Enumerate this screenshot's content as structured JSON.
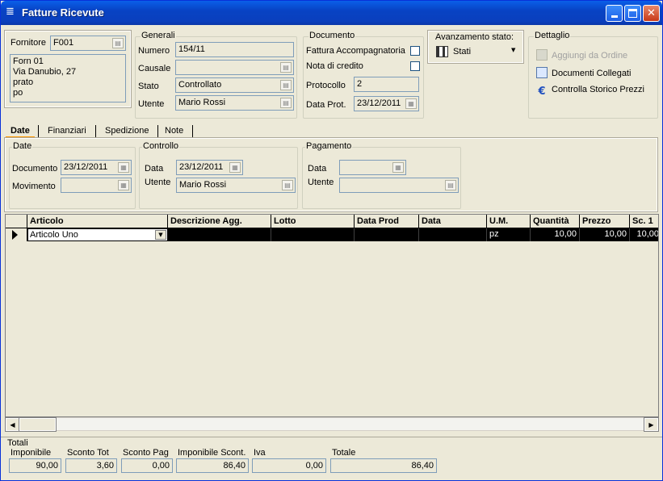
{
  "window": {
    "title": "Fatture Ricevute"
  },
  "fornitore": {
    "label": "Fornitore",
    "code": "F001",
    "address_lines": [
      "Forn 01",
      "Via Danubio, 27",
      "prato",
      "po"
    ]
  },
  "generali": {
    "title": "Generali",
    "numero_label": "Numero",
    "numero": "154/11",
    "causale_label": "Causale",
    "causale": "",
    "stato_label": "Stato",
    "stato": "Controllato",
    "utente_label": "Utente",
    "utente": "Mario Rossi"
  },
  "documento": {
    "title": "Documento",
    "fattura_accomp_label": "Fattura Accompagnatoria",
    "nota_credito_label": "Nota di credito",
    "protocollo_label": "Protocollo",
    "protocollo": "2",
    "data_prot_label": "Data Prot.",
    "data_prot": "23/12/2011"
  },
  "avanzamento": {
    "title": "Avanzamento stato:",
    "button_label": "Stati"
  },
  "dettaglio": {
    "title": "Dettaglio",
    "items": [
      {
        "label": "Aggiungi da Ordine",
        "icon": "document-icon",
        "enabled": false
      },
      {
        "label": "Documenti Collegati",
        "icon": "linked-documents-icon",
        "enabled": true
      },
      {
        "label": "Controlla Storico Prezzi",
        "icon": "euro-icon",
        "enabled": true
      }
    ]
  },
  "tabs": [
    "Date",
    "Finanziari",
    "Spedizione",
    "Note"
  ],
  "date_group": {
    "title": "Date",
    "documento_label": "Documento",
    "documento": "23/12/2011",
    "movimento_label": "Movimento",
    "movimento": ""
  },
  "controllo": {
    "title": "Controllo",
    "data_label": "Data",
    "data": "23/12/2011",
    "utente_label": "Utente",
    "utente": "Mario Rossi"
  },
  "pagamento": {
    "title": "Pagamento",
    "data_label": "Data",
    "data": "",
    "utente_label": "Utente",
    "utente": ""
  },
  "grid": {
    "columns": [
      "Articolo",
      "Descrizione Agg.",
      "Lotto",
      "Data Prod",
      "Data",
      "U.M.",
      "Quantità",
      "Prezzo",
      "Sc. 1"
    ],
    "rows": [
      {
        "articolo": "Articolo Uno",
        "descrizione": "",
        "lotto": "",
        "data_prod": "",
        "data": "",
        "um": "pz",
        "quantita": "10,00",
        "prezzo": "10,00",
        "sc1": "10,00"
      }
    ]
  },
  "totali": {
    "title": "Totali",
    "imponibile_label": "Imponibile",
    "imponibile": "90,00",
    "sconto_tot_label": "Sconto Tot",
    "sconto_tot": "3,60",
    "sconto_pag_label": "Sconto Pag",
    "sconto_pag": "0,00",
    "imponibile_scont_label": "Imponibile Scont.",
    "imponibile_scont": "86,40",
    "iva_label": "Iva",
    "iva": "0,00",
    "totale_label": "Totale",
    "totale": "86,40"
  }
}
